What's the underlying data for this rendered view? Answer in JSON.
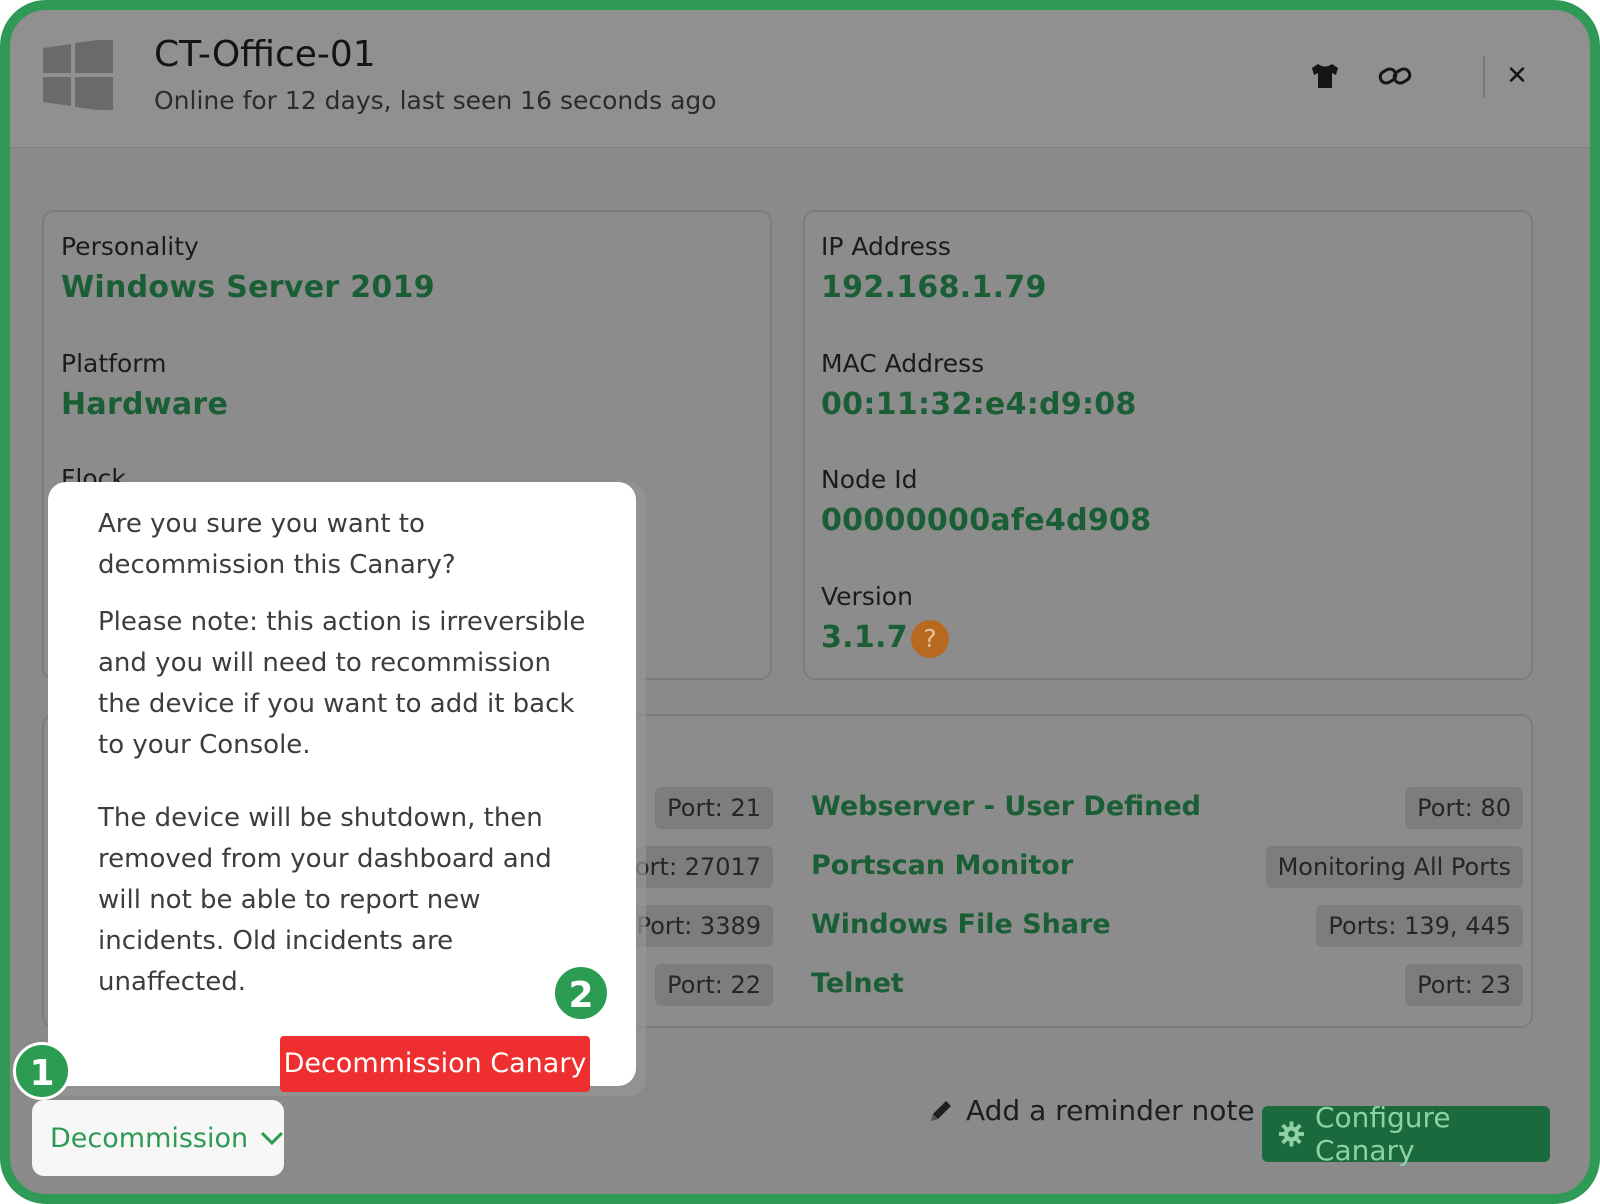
{
  "window": {
    "title": "CT-Office-01",
    "status": "Online for 12 days, last seen 16 seconds ago",
    "icons": [
      "windows-logo-icon",
      "shirt-icon",
      "link-icon",
      "close-icon"
    ],
    "close_glyph": "✕"
  },
  "details_left": {
    "personality_label": "Personality",
    "personality_value": "Windows Server 2019",
    "platform_label": "Platform",
    "platform_value": "Hardware",
    "flock_label": "Flock"
  },
  "details_right": {
    "ip_label": "IP Address",
    "ip_value": "192.168.1.79",
    "mac_label": "MAC Address",
    "mac_value": "00:11:32:e4:d9:08",
    "node_label": "Node Id",
    "node_value": "00000000afe4d908",
    "version_label": "Version",
    "version_value": "3.1.7",
    "help_glyph": "?"
  },
  "services": {
    "left_ports": [
      "Port: 21",
      "Port: 27017",
      "Port: 3389",
      "Port: 22"
    ],
    "right": [
      {
        "name": "Webserver - User Defined",
        "port": "Port: 80"
      },
      {
        "name": "Portscan Monitor",
        "port": "Monitoring All Ports"
      },
      {
        "name": "Windows File Share",
        "port": "Ports: 139, 445"
      },
      {
        "name": "Telnet",
        "port": "Port: 23"
      }
    ]
  },
  "footer": {
    "reminder_label": "Add a reminder note",
    "configure_label": "Configure Canary",
    "decommission_label": "Decommission"
  },
  "popover": {
    "question": "Are you sure you want to decommission this Canary?",
    "note": "Please note: this action is irreversible and you will need to recommission the device if you want to add it back to your Console.",
    "effect": "The device will be shutdown, then removed from your dashboard and will not be able to report new incidents. Old incidents are unaffected.",
    "confirm_label": "Decommission Canary"
  },
  "step_badges": [
    "1",
    "2"
  ],
  "colors": {
    "accent_green": "#2f9a56",
    "value_green": "#1a5e35",
    "danger_red": "#ef2f2f",
    "warning_orange": "#b86920"
  }
}
